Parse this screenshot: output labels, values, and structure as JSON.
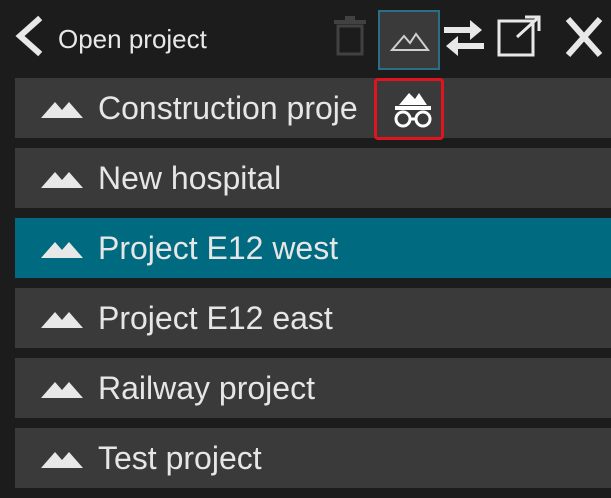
{
  "header": {
    "title": "Open project",
    "icons": {
      "back": "chevron-left-icon",
      "trash": "trash-icon",
      "view": "mountain-icon",
      "swap": "swap-icon",
      "open_external": "open-external-icon",
      "close": "close-icon"
    }
  },
  "projects": [
    {
      "label": "Construction proje",
      "selected": false
    },
    {
      "label": "New hospital",
      "selected": false
    },
    {
      "label": "Project E12 west",
      "selected": true
    },
    {
      "label": "Project E12 east",
      "selected": false
    },
    {
      "label": "Railway project",
      "selected": false
    },
    {
      "label": "Test project",
      "selected": false
    }
  ],
  "popup": {
    "icon": "mountain-glasses-icon"
  },
  "colors": {
    "background": "#1c1c1c",
    "item": "#3a3a3a",
    "selected": "#006a80",
    "highlight": "#e0141e",
    "focus": "#2b6f86"
  }
}
